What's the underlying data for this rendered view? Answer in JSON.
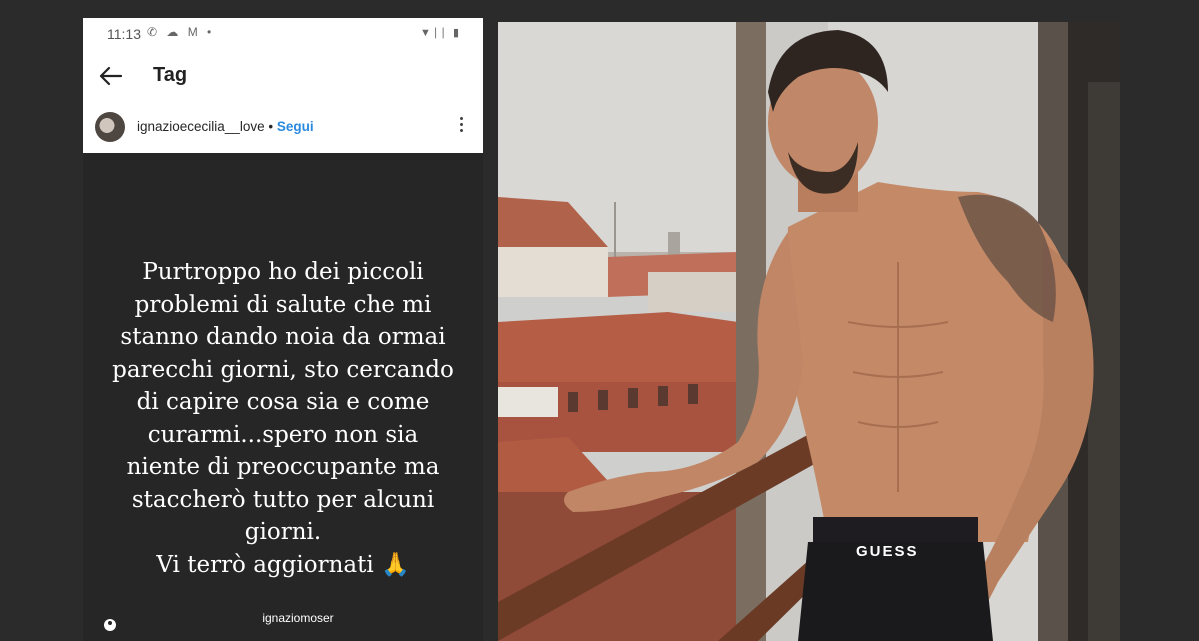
{
  "status_bar": {
    "time": "11:13",
    "left_icons": "✆ ☁ M •",
    "right_icons": "▼∣∣ ▮"
  },
  "nav": {
    "title": "Tag"
  },
  "post": {
    "username": "ignazioececilia__love",
    "separator": "•",
    "follow_label": "Segui"
  },
  "story": {
    "lines": [
      "Purtroppo ho dei piccoli",
      "problemi di salute che mi",
      "stanno dando noia da ormai",
      "parecchi giorni, sto cercando",
      "di capire cosa sia e come",
      "curarmi...spero non sia",
      "niente di preoccupante ma",
      "staccherò tutto per alcuni",
      "giorni.",
      "Vi terrò aggiornati 🙏"
    ],
    "author": "ignaziomoser"
  },
  "photo": {
    "brand_text": "GUESS"
  },
  "colors": {
    "background": "#2b2b2b",
    "story_bg": "#262626",
    "link": "#2a8ae0"
  }
}
